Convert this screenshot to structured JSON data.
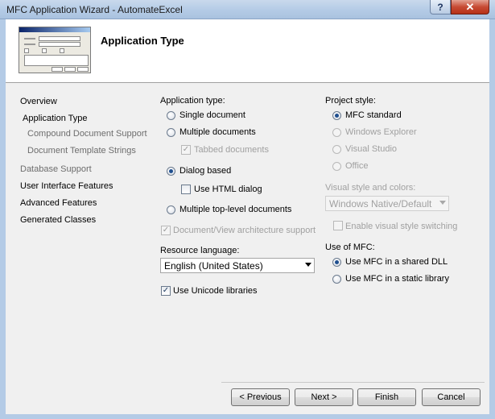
{
  "window": {
    "title": "MFC Application Wizard - AutomateExcel",
    "help_label": "?",
    "close_label": "✕"
  },
  "header": {
    "title": "Application Type"
  },
  "sidebar": {
    "items": [
      {
        "label": "Overview",
        "state": "enabled"
      },
      {
        "label": "Application Type",
        "state": "current"
      },
      {
        "label": "Compound Document Support",
        "state": "sub"
      },
      {
        "label": "Document Template Strings",
        "state": "sub"
      },
      {
        "label": "Database Support",
        "state": "disabled"
      },
      {
        "label": "User Interface Features",
        "state": "enabled"
      },
      {
        "label": "Advanced Features",
        "state": "enabled"
      },
      {
        "label": "Generated Classes",
        "state": "enabled"
      }
    ]
  },
  "app_type": {
    "label": "Application type:",
    "single": "Single document",
    "multiple": "Multiple documents",
    "tabbed": "Tabbed documents",
    "dialog": "Dialog based",
    "html_dialog": "Use HTML dialog",
    "top_level": "Multiple top-level documents",
    "doc_view": "Document/View architecture support",
    "selected": "Dialog based"
  },
  "resource": {
    "label": "Resource language:",
    "value": "English (United States)"
  },
  "unicode": {
    "label": "Use Unicode libraries",
    "checked": true
  },
  "project_style": {
    "label": "Project style:",
    "mfc_standard": "MFC standard",
    "windows_explorer": "Windows Explorer",
    "visual_studio": "Visual Studio",
    "office": "Office",
    "selected": "MFC standard"
  },
  "visual_style": {
    "label": "Visual style and colors:",
    "value": "Windows Native/Default",
    "switching": "Enable visual style switching"
  },
  "mfc_use": {
    "label": "Use of MFC:",
    "shared": "Use MFC in a shared DLL",
    "static": "Use MFC in a static library",
    "selected": "Use MFC in a shared DLL"
  },
  "buttons": {
    "previous": "< Previous",
    "next": "Next >",
    "finish": "Finish",
    "cancel": "Cancel"
  },
  "glyphs": {
    "check": "✓"
  }
}
